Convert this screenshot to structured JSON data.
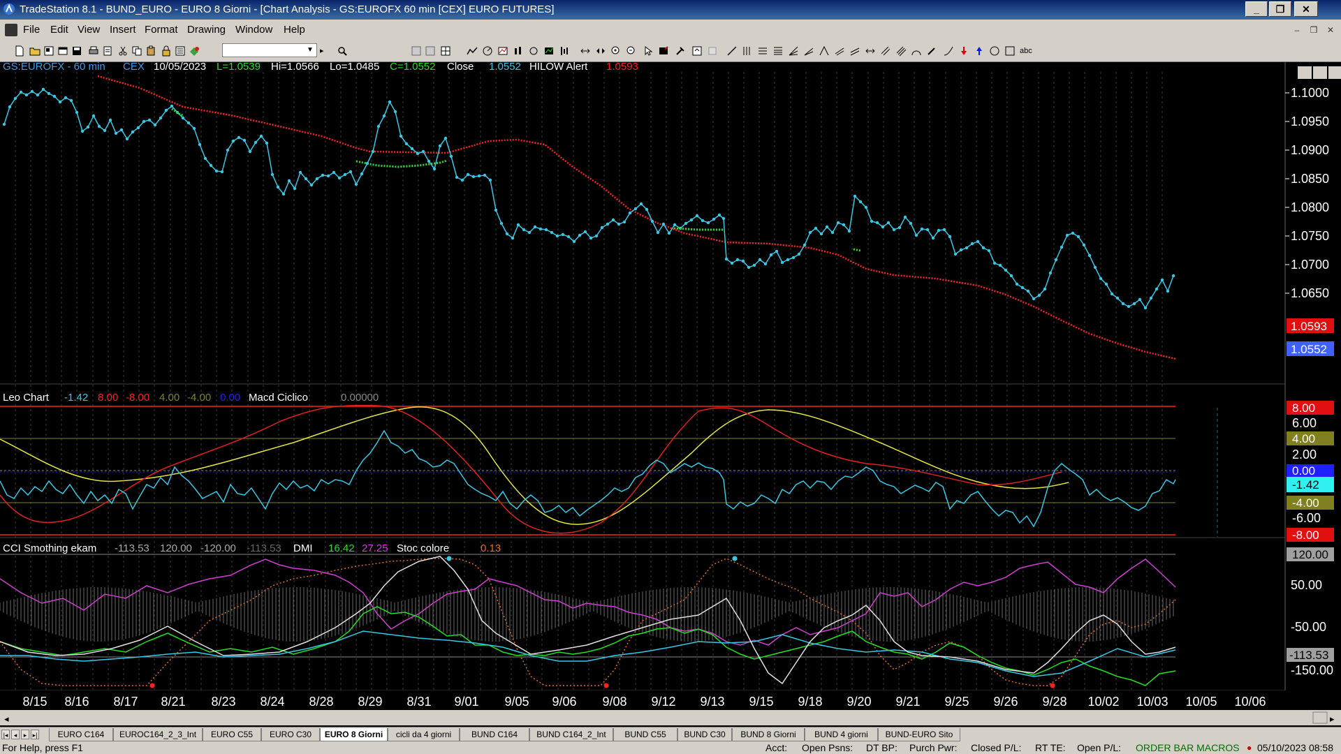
{
  "window": {
    "title": "TradeStation 8.1 - BUND_EURO - EURO 8 Giorni - [Chart Analysis - GS:EUROFX  60 min  [CEX] EURO FUTURES]"
  },
  "menu": [
    "File",
    "Edit",
    "View",
    "Insert",
    "Format",
    "Drawing",
    "Window",
    "Help"
  ],
  "price_panel": {
    "symbol": "GS:EUROFX - 60 min",
    "exchange": "CEX",
    "date": "10/05/2023",
    "low_label": "L=1.0539",
    "high_label": "Hi=1.0566",
    "lo_label": "Lo=1.0485",
    "close_label": "C=1.0552",
    "close_name": "Close",
    "close_value": "1.0552",
    "alert_name": "HILOW Alert",
    "alert_value": "1.0593",
    "axis_ticks": [
      "1.1000",
      "1.0950",
      "1.0900",
      "1.0850",
      "1.0800",
      "1.0750",
      "1.0700",
      "1.0650"
    ],
    "marker_red": "1.0593",
    "marker_blue": "1.0552"
  },
  "leo_panel": {
    "title": "Leo Chart",
    "values": [
      "-1.42",
      "8.00",
      "-8.00",
      "4.00",
      "-4.00",
      "0.00"
    ],
    "macd_name": "Macd Ciclico",
    "macd_value": "0.00000",
    "axis_ticks": [
      "6.00",
      "2.00",
      "-6.00"
    ],
    "markers": {
      "red_top": "8.00",
      "olive_top": "4.00",
      "blue": "0.00",
      "cyan": "-1.42",
      "olive_bottom": "-4.00",
      "red_bottom": "-8.00"
    }
  },
  "cci_panel": {
    "title": "CCI Smothing ekam",
    "values": [
      "-113.53",
      "120.00",
      "-120.00",
      "-113.53"
    ],
    "dmi_name": "DMI",
    "dmi_values": [
      "16.42",
      "27.25"
    ],
    "stoc_name": "Stoc colore",
    "stoc_value": "0.13",
    "axis_ticks": [
      "50.00",
      "-50.00",
      "-150.00"
    ],
    "markers": {
      "top": "120.00",
      "current": "-113.53"
    }
  },
  "x_axis": [
    "8/15",
    "8/16",
    "8/17",
    "8/21",
    "8/23",
    "8/24",
    "8/28",
    "8/29",
    "8/31",
    "9/01",
    "9/05",
    "9/06",
    "9/08",
    "9/12",
    "9/13",
    "9/15",
    "9/18",
    "9/20",
    "9/21",
    "9/25",
    "9/26",
    "9/28",
    "10/02",
    "10/03",
    "10/05",
    "10/06"
  ],
  "tabs": [
    "EURO C164",
    "EUROC164_2_3_Int",
    "EURO C55",
    "EURO C30",
    "EURO 8 Giorni",
    "cicli da 4 giorni",
    "BUND C164",
    "BUND C164_2_Int",
    "BUND C55",
    "BUND  C30",
    "BUND 8 Giorni",
    "BUND 4 giorni",
    "BUND-EURO Sito"
  ],
  "active_tab": "EURO 8 Giorni",
  "status": {
    "help": "For Help, press F1",
    "acct": "Acct:",
    "open_psns": "Open Psns:",
    "dt_bp": "DT BP:",
    "purch_pwr": "Purch Pwr:",
    "closed_pl": "Closed P/L:",
    "rt_te": "RT TE:",
    "open_pl": "Open P/L:",
    "macros": "ORDER BAR  MACROS",
    "datetime": "05/10/2023 08:58"
  },
  "colors": {
    "cyan": "#37c8e6",
    "red": "#ff2020",
    "green": "#22e022",
    "yellow": "#e6e640",
    "magenta": "#d040d0",
    "olive": "#808020",
    "axis_bg": "#000000"
  }
}
